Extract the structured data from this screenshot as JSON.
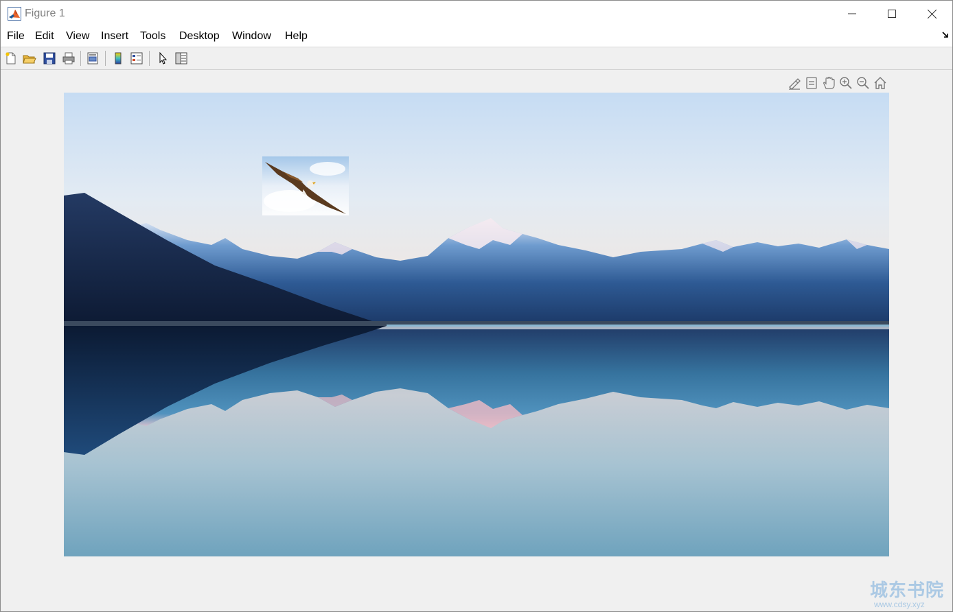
{
  "window": {
    "title": "Figure 1"
  },
  "menu": {
    "items": [
      "File",
      "Edit",
      "View",
      "Insert",
      "Tools",
      "Desktop",
      "Window",
      "Help"
    ]
  },
  "toolbar": {
    "buttons": [
      "new-figure-icon",
      "open-file-icon",
      "save-icon",
      "print-icon",
      "print-preview-icon",
      "insert-colorbar-icon",
      "insert-legend-icon",
      "edit-plot-icon",
      "property-inspector-icon"
    ]
  },
  "axes_toolbar": {
    "buttons": [
      "brush-icon",
      "data-tips-icon",
      "pan-icon",
      "zoom-in-icon",
      "zoom-out-icon",
      "restore-view-icon"
    ]
  },
  "figure": {
    "image": "mountain-lake-photo",
    "inset": "eagle-photo"
  },
  "watermark": {
    "title": "城东书院",
    "url": "www.cdsy.xyz"
  }
}
